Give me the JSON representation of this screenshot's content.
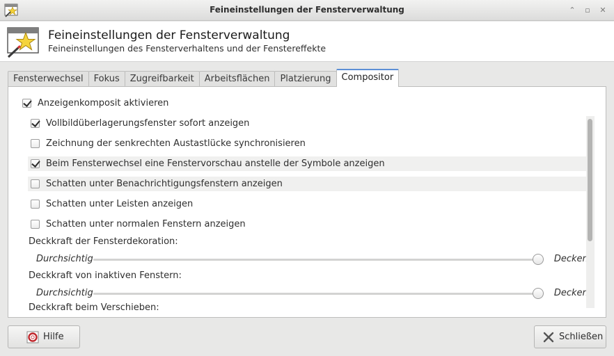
{
  "window": {
    "title": "Feineinstellungen der Fensterverwaltung"
  },
  "header": {
    "title": "Feineinstellungen der Fensterverwaltung",
    "subtitle": "Feineinstellungen des Fensterverhaltens und der Fenstereffekte"
  },
  "tabs": [
    {
      "label": "Fensterwechsel",
      "active": false
    },
    {
      "label": "Fokus",
      "active": false
    },
    {
      "label": "Zugreifbarkeit",
      "active": false
    },
    {
      "label": "Arbeitsflächen",
      "active": false
    },
    {
      "label": "Platzierung",
      "active": false
    },
    {
      "label": "Compositor",
      "active": true
    }
  ],
  "compositor": {
    "enable": {
      "label": "Anzeigenkomposit aktivieren",
      "checked": true
    },
    "options": [
      {
        "label": "Vollbildüberlagerungsfenster sofort anzeigen",
        "checked": true
      },
      {
        "label": "Zeichnung der senkrechten Austastlücke synchronisieren",
        "checked": false
      },
      {
        "label": "Beim Fensterwechsel eine Fenstervorschau anstelle der Symbole anzeigen",
        "checked": true
      },
      {
        "label": "Schatten unter Benachrichtigungsfenstern anzeigen",
        "checked": false
      },
      {
        "label": "Schatten unter Leisten anzeigen",
        "checked": false
      },
      {
        "label": "Schatten unter normalen Fenstern anzeigen",
        "checked": false
      }
    ],
    "sliders": [
      {
        "label": "Deckkraft der Fensterdekoration:",
        "min_label": "Durchsichtig",
        "max_label": "Deckend",
        "value_fraction": 1.0
      },
      {
        "label": "Deckkraft von inaktiven Fenstern:",
        "min_label": "Durchsichtig",
        "max_label": "Deckend",
        "value_fraction": 1.0
      }
    ],
    "clipped_label": "Deckkraft beim Verschieben:"
  },
  "buttons": {
    "help": "Hilfe",
    "close": "Schließen"
  },
  "colors": {
    "accent": "#5c8fd6",
    "window_bg": "#e8e8e7"
  },
  "icons": {
    "app": "window-star-icon",
    "help": "lifebuoy-icon",
    "close": "x-icon"
  }
}
